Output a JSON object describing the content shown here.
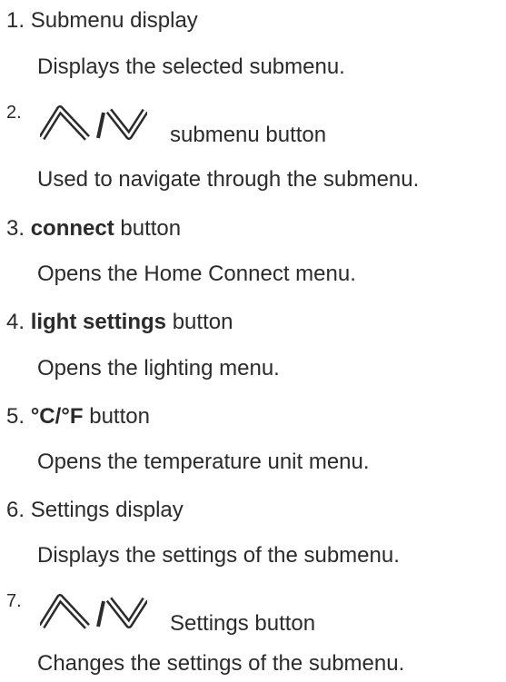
{
  "items": [
    {
      "number": "1.",
      "title": "Submenu display",
      "description": "Displays the selected submenu."
    },
    {
      "number": "2.",
      "icons": [
        "chevron-up-icon",
        "slash-icon",
        "chevron-down-icon"
      ],
      "title": "submenu button",
      "description": "Used to navigate through the submenu."
    },
    {
      "number": "3.",
      "title_bold": "connect",
      "title": "button",
      "description": "Opens the Home Connect menu."
    },
    {
      "number": "4.",
      "title_bold": "light settings",
      "title": "button",
      "description": "Opens the lighting menu."
    },
    {
      "number": "5.",
      "title_bold": "°C/°F",
      "title": "button",
      "description": "Opens the temperature unit menu."
    },
    {
      "number": "6.",
      "title": "Settings display",
      "description": "Displays the settings of the submenu."
    },
    {
      "number": "7.",
      "icons": [
        "chevron-up-icon",
        "slash-icon",
        "chevron-down-icon"
      ],
      "title": "Settings button",
      "description": "Changes the settings of the submenu."
    }
  ],
  "colors": {
    "text": "#2b2b2b",
    "icon": "#2b2b2b"
  }
}
